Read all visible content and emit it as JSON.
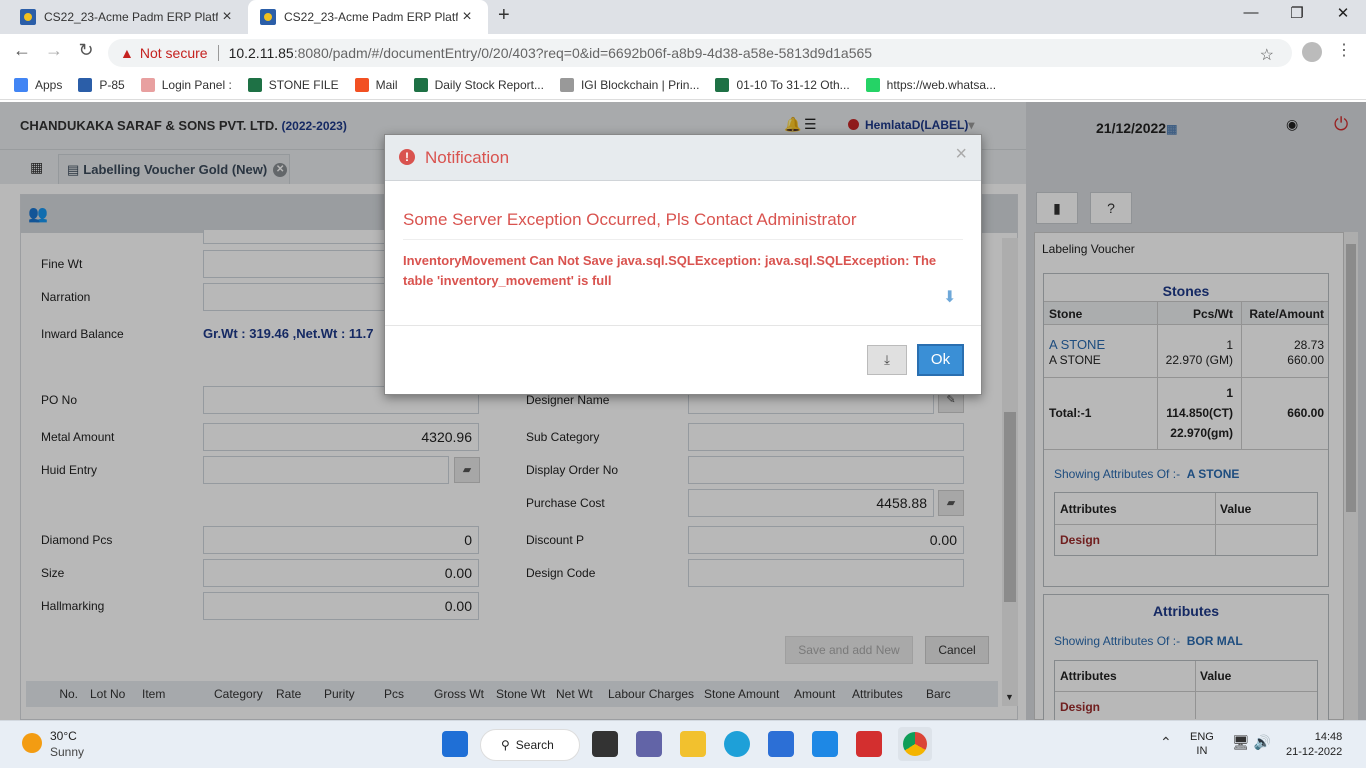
{
  "browser": {
    "tabs": [
      {
        "title": "CS22_23-Acme Padm ERP Platfor",
        "active": false
      },
      {
        "title": "CS22_23-Acme Padm ERP Platfor",
        "active": true
      }
    ],
    "new_tab": "+",
    "window_controls": {
      "minimize": "—",
      "maximize": "❐",
      "close": "✕"
    },
    "security": "Not secure",
    "url_host": "10.2.11.85",
    "url_path": ":8080/padm/#/documentEntry/0/20/403?req=0&id=6692b06f-a8b9-4d38-a58e-5813d9d1a565",
    "bookmarks": [
      {
        "label": "Apps",
        "icon": "apps-grid-icon",
        "color": "#4285f4"
      },
      {
        "label": "P-85",
        "icon": "padm-icon",
        "color": "#2b5ea8"
      },
      {
        "label": "Login Panel :",
        "icon": "login-icon",
        "color": "#e8a0a0"
      },
      {
        "label": "STONE FILE",
        "icon": "excel-icon",
        "color": "#1e7145"
      },
      {
        "label": "Mail",
        "icon": "microsoft-icon",
        "color": "#f25022"
      },
      {
        "label": "Daily Stock Report...",
        "icon": "excel-icon",
        "color": "#1e7145"
      },
      {
        "label": "IGI Blockchain | Prin...",
        "icon": "igi-icon",
        "color": "#999999"
      },
      {
        "label": "01-10 To 31-12 Oth...",
        "icon": "excel-icon",
        "color": "#1e7145"
      },
      {
        "label": "https://web.whatsa...",
        "icon": "whatsapp-icon",
        "color": "#25d366"
      }
    ]
  },
  "header": {
    "company": "CHANDUKAKA SARAF & SONS PVT. LTD.",
    "year": "(2022-2023)",
    "user": "HemlataD(LABEL)",
    "user_caret": "▾",
    "date": "21/12/2022"
  },
  "voucher_tab": {
    "label": "Labelling Voucher Gold (New)",
    "close": "✕"
  },
  "form": {
    "fine_wt_label": "Fine Wt",
    "narration_label": "Narration",
    "inward_balance_label": "Inward Balance",
    "inward_balance_value": "Gr.Wt : 319.46 ,Net.Wt : 11.7",
    "po_no_label": "PO No",
    "metal_amount_label": "Metal Amount",
    "metal_amount_value": "4320.96",
    "huid_label": "Huid Entry",
    "diamond_pcs_label": "Diamond Pcs",
    "diamond_pcs_value": "0",
    "size_label": "Size",
    "size_value": "0.00",
    "hallmarking_label": "Hallmarking",
    "hallmarking_value": "0.00",
    "designer_label": "Designer Name",
    "sub_category_label": "Sub Category",
    "display_order_label": "Display Order No",
    "purchase_cost_label": "Purchase Cost",
    "purchase_cost_value": "4458.88",
    "discount_label": "Discount P",
    "discount_value": "0.00",
    "design_code_label": "Design Code",
    "save_add_label": "Save and add New",
    "cancel_label": "Cancel"
  },
  "grid_columns": [
    "No.",
    "Lot No",
    "Item",
    "Category",
    "Rate",
    "Purity",
    "Pcs",
    "Gross Wt",
    "Stone Wt",
    "Net Wt",
    "Labour Charges",
    "Stone Amount",
    "Amount",
    "Attributes",
    "Barc"
  ],
  "right_panel": {
    "title": "Labeling Voucher",
    "stones": {
      "title": "Stones",
      "headers": [
        "Stone",
        "Pcs/Wt",
        "Rate/Amount"
      ],
      "row": {
        "name1": "A STONE",
        "name2": "A STONE",
        "pcs": "1",
        "wt": "22.970 (GM)",
        "rate": "28.73",
        "amount": "660.00"
      },
      "total": {
        "label": "Total:-1",
        "pcs": "1",
        "ct": "114.850(CT)",
        "gm": "22.970(gm)",
        "amount": "660.00"
      },
      "showing_label": "Showing Attributes Of :-",
      "showing_value": "A STONE",
      "attr_headers": [
        "Attributes",
        "Value"
      ],
      "attr_row": "Design"
    },
    "attributes": {
      "title": "Attributes",
      "showing_label": "Showing Attributes Of :-",
      "showing_value": "BOR MAL",
      "attr_headers": [
        "Attributes",
        "Value"
      ],
      "attr_row": "Design"
    }
  },
  "modal": {
    "title": "Notification",
    "close": "×",
    "message": "Some Server Exception Occurred, Pls Contact Administrator",
    "detail": "InventoryMovement Can Not Save java.sql.SQLException: java.sql.SQLException: The table 'inventory_movement' is full",
    "ok_label": "Ok"
  },
  "taskbar": {
    "temperature": "30°C",
    "weather": "Sunny",
    "search_label": "Search",
    "lang1": "ENG",
    "lang2": "IN",
    "time": "14:48",
    "date": "21-12-2022"
  }
}
